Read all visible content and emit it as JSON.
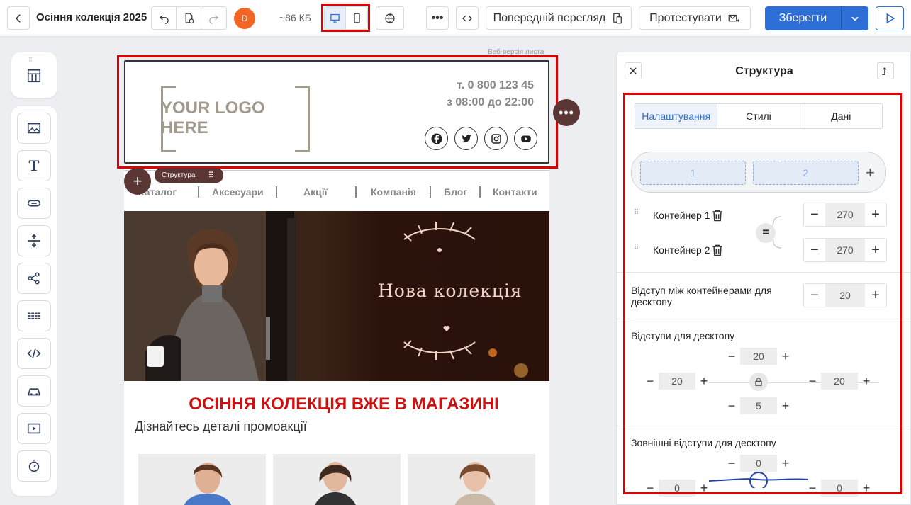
{
  "topbar": {
    "title": "Осіння колекція 2025",
    "avatar_initial": "D",
    "size": "~86 КБ",
    "preview_label": "Попередній перегляд",
    "test_label": "Протестувати",
    "save_label": "Зберегти"
  },
  "canvas": {
    "web_version": "Веб-версія листа",
    "logo_text": "YOUR LOGO HERE",
    "phone": "т. 0 800 123 45",
    "hours": "з 08:00 до 22:00",
    "nav": [
      "Каталог",
      "Аксесуари",
      "Акції",
      "Компанія",
      "Блог",
      "Контакти"
    ],
    "hero_title": "Нова колекція",
    "promo_title": "ОСІННЯ КОЛЕКЦІЯ ВЖЕ В МАГАЗИНІ",
    "promo_subtitle": "Дізнайтесь деталі промоакції",
    "structure_tag": "Структура"
  },
  "panel": {
    "title": "Структура",
    "tabs": [
      "Налаштування",
      "Стилі",
      "Дані"
    ],
    "columns": [
      "1",
      "2"
    ],
    "containers": [
      {
        "label": "Контейнер 1",
        "value": "270"
      },
      {
        "label": "Контейнер 2",
        "value": "270"
      }
    ],
    "gap_label": "Відступ між контейнерами для десктопу",
    "gap_value": "20",
    "padding_label": "Відступи для десктопу",
    "padding": {
      "top": "20",
      "left": "20",
      "right": "20",
      "bottom": "5"
    },
    "margin_label": "Зовнішні відступи для десктопу",
    "margin": {
      "top": "0",
      "left": "0",
      "right": "0"
    }
  },
  "colors": {
    "accent": "#2d6fd6",
    "highlight": "#e00000",
    "control_brown": "#5a3634",
    "promo_red": "#cc1111"
  }
}
